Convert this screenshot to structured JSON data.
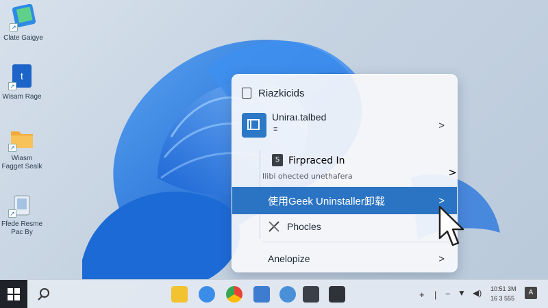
{
  "desktop": {
    "icons": [
      {
        "label": "Clate Gaigye",
        "icon": "photos-app-icon"
      },
      {
        "label": "Wisam Rage",
        "icon": "word-doc-icon"
      },
      {
        "label": "Wiasm Fagget Sealk",
        "icon": "folder-icon"
      },
      {
        "label": "Ffede Resme Pac By",
        "icon": "recycle-bin-icon"
      }
    ]
  },
  "menu": {
    "header": "Riazkicids",
    "app_title": "Uniraı.talbed",
    "app_subtitle": "≡",
    "firpraced_title": "Firpraced In",
    "firpraced_sub": "Ilibi ohected unethafera",
    "highlighted_item": "使用Geek Uninstaller卸载",
    "phocles": "Phocles",
    "anelopize": "Anelopize",
    "chevron": ">"
  },
  "taskbar": {
    "tray_time": "10:51 3M",
    "tray_date": "16 3 555",
    "tray_badge": "A"
  },
  "colors": {
    "highlight": "#2b74c3",
    "wallpaper_blue": "#1f6fd1",
    "taskbar_bg": "#e2e8f0"
  }
}
